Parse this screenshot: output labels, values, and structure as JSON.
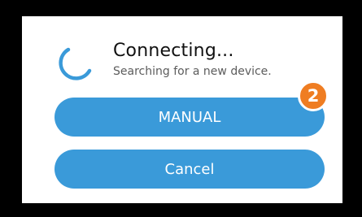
{
  "dialog": {
    "title": "Connecting...",
    "subtitle": "Searching for a new device.",
    "spinner_icon": "loading-spinner-icon",
    "manual_button_label": "MANUAL",
    "cancel_button_label": "Cancel"
  },
  "annotation": {
    "step_number": "2"
  },
  "colors": {
    "button_bg": "#3a9ad9",
    "spinner": "#3a9ad9",
    "badge_bg": "#ef7d22",
    "background": "#000000",
    "dialog_bg": "#ffffff"
  }
}
